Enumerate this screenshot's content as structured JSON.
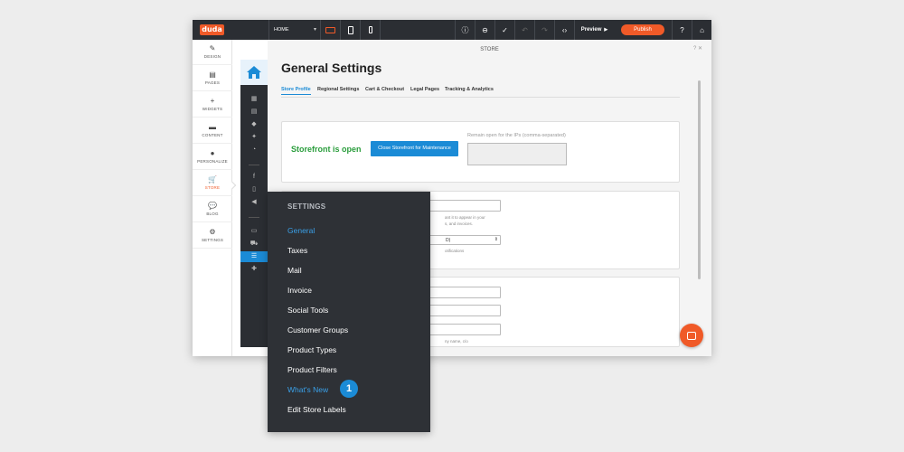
{
  "topbar": {
    "logo": "duda",
    "page_select": "HOME",
    "chevron": "▾",
    "preview_label": "Preview",
    "preview_arrow": "▶",
    "publish_label": "Publish"
  },
  "left_nav": [
    {
      "icon": "✎",
      "label": "DESIGN"
    },
    {
      "icon": "▤",
      "label": "PAGES"
    },
    {
      "icon": "+",
      "label": "WIDGETS"
    },
    {
      "icon": "▬",
      "label": "CONTENT"
    },
    {
      "icon": "●",
      "label": "PERSONALIZE"
    },
    {
      "icon": "🛒",
      "label": "STORE"
    },
    {
      "icon": "💬",
      "label": "BLOG"
    },
    {
      "icon": "⚙",
      "label": "SETTINGS"
    }
  ],
  "content": {
    "store_title": "STORE",
    "header_icons": "? ✕",
    "title": "General Settings",
    "tabs": [
      "Store Profile",
      "Regional Settings",
      "Cart & Checkout",
      "Legal Pages",
      "Tracking & Analytics"
    ],
    "storefront_status": "Storefront is open",
    "close_button": "Close Storefront for Maintenance",
    "remain_label": "Remain open for the IPs (comma-separated)",
    "card2": {
      "hint1": "ant it to appear in your",
      "hint2": "s, and invoices.",
      "select_value": "D)",
      "hint3": "otifications"
    },
    "card3": {
      "hint": "ny name, c/o"
    }
  },
  "flyout": {
    "heading": "SETTINGS",
    "items": [
      "General",
      "Taxes",
      "Mail",
      "Invoice",
      "Social Tools",
      "Customer Groups",
      "Product Types",
      "Product Filters",
      "What's New",
      "Edit Store Labels"
    ],
    "active_item": "General",
    "highlight_item": "What's New",
    "badge": "1"
  },
  "colors": {
    "accent_orange": "#f05a28",
    "accent_blue": "#1b8bd6",
    "success_green": "#2a9d3c",
    "dark": "#2b2e33"
  }
}
